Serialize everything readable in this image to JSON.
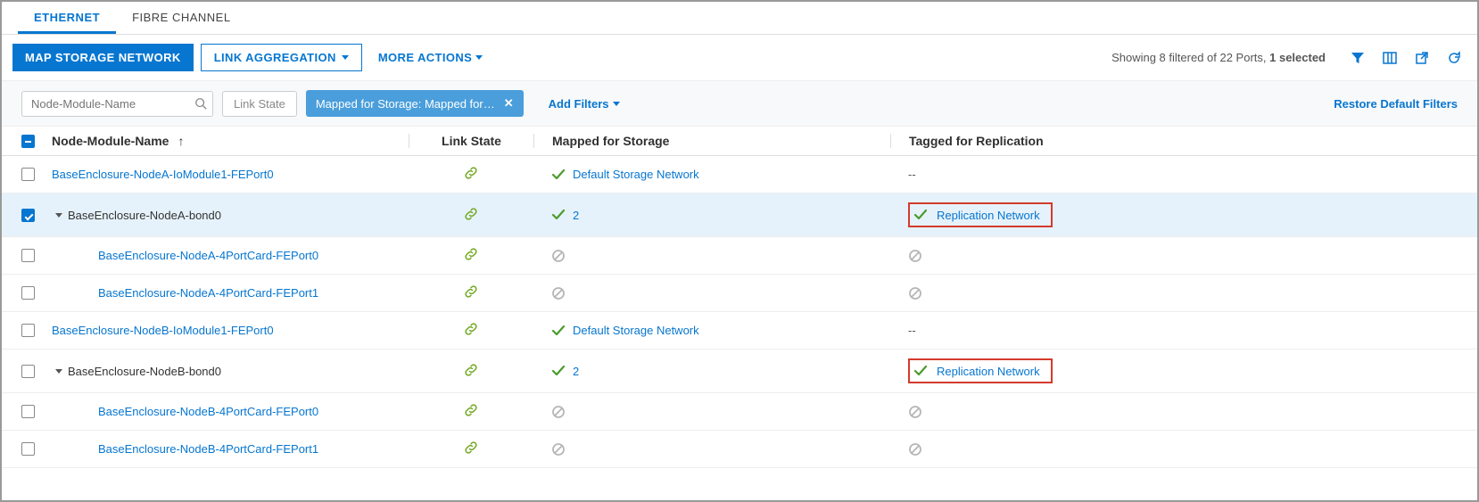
{
  "tabs": {
    "ethernet": "ETHERNET",
    "fibre": "FIBRE CHANNEL"
  },
  "toolbar": {
    "map": "MAP STORAGE NETWORK",
    "linkagg": "LINK AGGREGATION",
    "more": "MORE ACTIONS"
  },
  "status": {
    "prefix": "Showing 8 filtered of 22 Ports, ",
    "bold": "1 selected"
  },
  "filters": {
    "search_placeholder": "Node-Module-Name",
    "linkstate": "Link State",
    "mapped_chip": "Mapped for Storage: Mapped for…",
    "add": "Add Filters",
    "restore": "Restore Default Filters"
  },
  "columns": {
    "name": "Node-Module-Name",
    "link": "Link State",
    "storage": "Mapped for Storage",
    "repl": "Tagged for Replication"
  },
  "rows": [
    {
      "name": "BaseEnclosure-NodeA-IoModule1-FEPort0",
      "link": true,
      "storage_type": "text",
      "storage": "Default Storage Network",
      "repl_type": "dash",
      "indent": 0,
      "checked": false,
      "expand": false,
      "nameStyle": "link"
    },
    {
      "name": "BaseEnclosure-NodeA-bond0",
      "link": true,
      "storage_type": "count",
      "storage": "2",
      "repl_type": "link",
      "repl": "Replication Network",
      "repl_highlight": true,
      "indent": 0,
      "checked": true,
      "expand": true,
      "nameStyle": "plain",
      "selected": true
    },
    {
      "name": "BaseEnclosure-NodeA-4PortCard-FEPort0",
      "link": true,
      "storage_type": "ban",
      "repl_type": "ban",
      "indent": 1,
      "checked": false,
      "expand": false,
      "nameStyle": "link"
    },
    {
      "name": "BaseEnclosure-NodeA-4PortCard-FEPort1",
      "link": true,
      "storage_type": "ban",
      "repl_type": "ban",
      "indent": 1,
      "checked": false,
      "expand": false,
      "nameStyle": "link"
    },
    {
      "name": "BaseEnclosure-NodeB-IoModule1-FEPort0",
      "link": true,
      "storage_type": "text",
      "storage": "Default Storage Network",
      "repl_type": "dash",
      "indent": 0,
      "checked": false,
      "expand": false,
      "nameStyle": "link"
    },
    {
      "name": "BaseEnclosure-NodeB-bond0",
      "link": true,
      "storage_type": "count",
      "storage": "2",
      "repl_type": "link",
      "repl": "Replication Network",
      "repl_highlight": true,
      "indent": 0,
      "checked": false,
      "expand": true,
      "nameStyle": "plain"
    },
    {
      "name": "BaseEnclosure-NodeB-4PortCard-FEPort0",
      "link": true,
      "storage_type": "ban",
      "repl_type": "ban",
      "indent": 1,
      "checked": false,
      "expand": false,
      "nameStyle": "link"
    },
    {
      "name": "BaseEnclosure-NodeB-4PortCard-FEPort1",
      "link": true,
      "storage_type": "ban",
      "repl_type": "ban",
      "indent": 1,
      "checked": false,
      "expand": false,
      "nameStyle": "link"
    }
  ]
}
